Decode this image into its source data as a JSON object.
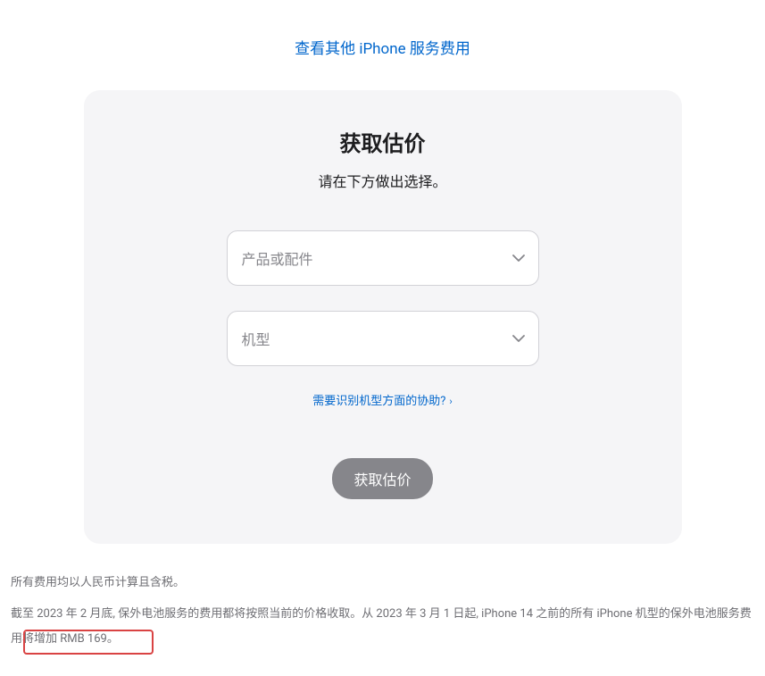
{
  "top_link": "查看其他 iPhone 服务费用",
  "card": {
    "title": "获取估价",
    "subtitle": "请在下方做出选择。",
    "select_product_placeholder": "产品或配件",
    "select_model_placeholder": "机型",
    "help_link_text": "需要识别机型方面的协助?",
    "submit_label": "获取估价"
  },
  "footer": {
    "line1": "所有费用均以人民币计算且含税。",
    "line2_part1": "截至 2023 年 2 月底, 保外电池服务的费用都将按照当前的价格收取。从 2023 年 3 月 1 日起, iPhone 14 之前的所有 iPhone 机型的保外电池服务",
    "line2_part2": "费用将增加 RMB 169。"
  }
}
